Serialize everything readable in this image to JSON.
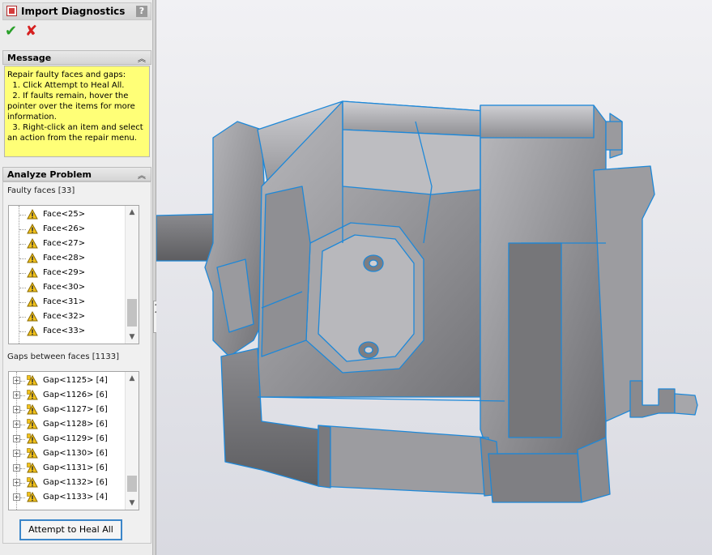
{
  "panel": {
    "title": "Import Diagnostics",
    "help_icon": "?",
    "ok_icon": "checkmark-icon",
    "cancel_icon": "x-icon"
  },
  "message": {
    "header": "Message",
    "lines": [
      "Repair faulty faces and gaps:",
      "  1. Click Attempt to Heal All.",
      "  2. If faults remain, hover the",
      "pointer over the items for more",
      "information.",
      "  3. Right-click an item and select",
      "an action from the repair menu."
    ]
  },
  "analyze": {
    "header": "Analyze Problem",
    "faulty_faces_label": "Faulty faces [33]",
    "faces": [
      "Face<25>",
      "Face<26>",
      "Face<27>",
      "Face<28>",
      "Face<29>",
      "Face<30>",
      "Face<31>",
      "Face<32>",
      "Face<33>"
    ],
    "gaps_label": "Gaps between faces [1133]",
    "gaps": [
      "Gap<1125> [4]",
      "Gap<1126> [6]",
      "Gap<1127> [6]",
      "Gap<1128> [6]",
      "Gap<1129> [6]",
      "Gap<1130> [6]",
      "Gap<1131> [6]",
      "Gap<1132> [6]",
      "Gap<1133> [4]"
    ],
    "heal_button": "Attempt to Heal All"
  },
  "colors": {
    "message_bg": "#ffff77",
    "model_gray": "#8e8e8e",
    "edge_blue": "#1e88d8",
    "warn_yellow": "#f2c21b"
  }
}
